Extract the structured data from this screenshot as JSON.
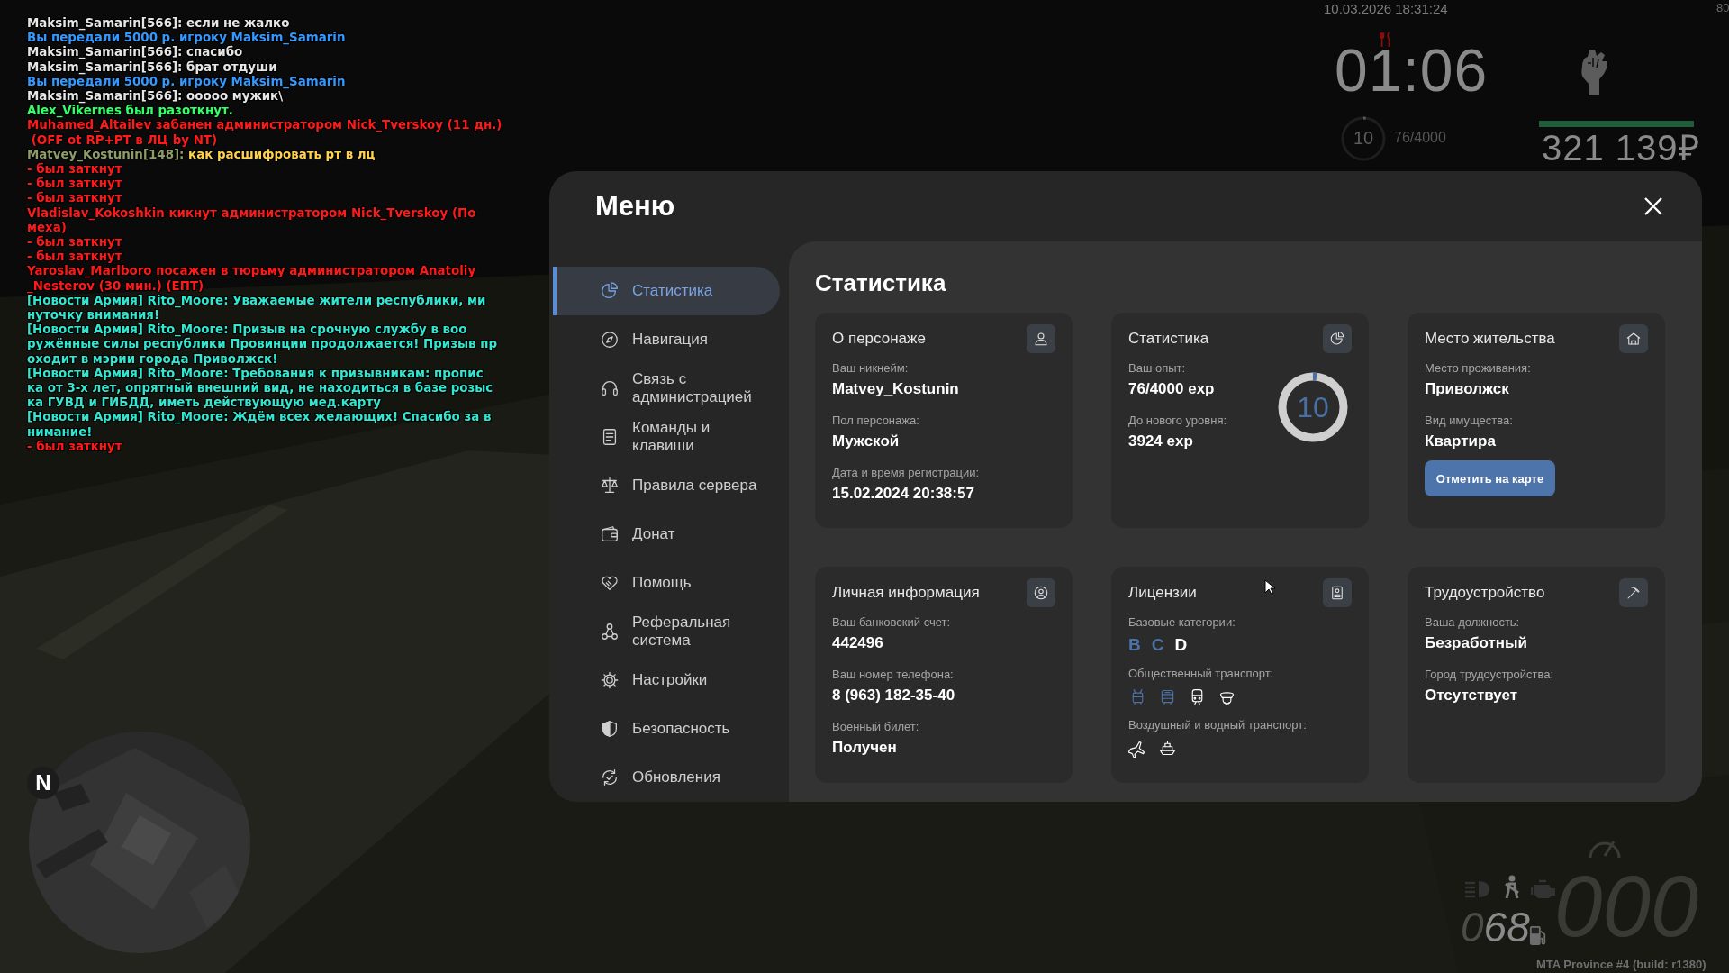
{
  "chat": [
    {
      "parts": [
        {
          "text": "Maksim_Samarin[566]: если не жалко",
          "color": "#e6e6e6"
        }
      ]
    },
    {
      "parts": [
        {
          "text": "Вы передали 5000 р. игроку Maksim_Samarin",
          "color": "#3399ff"
        }
      ]
    },
    {
      "parts": [
        {
          "text": "Maksim_Samarin[566]: спасибо",
          "color": "#e6e6e6"
        }
      ]
    },
    {
      "parts": [
        {
          "text": "Maksim_Samarin[566]: брат отдуши",
          "color": "#e6e6e6"
        }
      ]
    },
    {
      "parts": [
        {
          "text": "Вы передали 5000 р. игроку Maksim_Samarin",
          "color": "#3399ff"
        }
      ]
    },
    {
      "parts": [
        {
          "text": "Maksim_Samarin[566]: ооооо мужик\\",
          "color": "#e6e6e6"
        }
      ]
    },
    {
      "parts": [
        {
          "text": "Alex_Vikernes был разоткнут.",
          "color": "#33ff66"
        }
      ]
    },
    {
      "parts": [
        {
          "text": "Muhamed_Altailev забанен администратором Nick_Tverskoy (11 дн.)",
          "color": "#ff1a1a"
        }
      ]
    },
    {
      "parts": [
        {
          "text": " (OFF ot RP+PT в ЛЦ by NT)",
          "color": "#ff1a1a"
        }
      ]
    },
    {
      "parts": [
        {
          "text": "Matvey_Kostunin[148]: ",
          "color": "#8f9c6a"
        },
        {
          "text": "как расшифровать рт в лц",
          "color": "#ffd24d"
        }
      ]
    },
    {
      "parts": [
        {
          "text": "- был заткнут",
          "color": "#ff1a1a"
        }
      ]
    },
    {
      "parts": [
        {
          "text": "- был заткнут",
          "color": "#ff1a1a"
        }
      ]
    },
    {
      "parts": [
        {
          "text": "- был заткнут",
          "color": "#ff1a1a"
        }
      ]
    },
    {
      "parts": [
        {
          "text": "Vladislav_Kokoshkin кикнут администратором Nick_Tverskoy (По",
          "color": "#ff1a1a"
        }
      ]
    },
    {
      "parts": [
        {
          "text": "меха)",
          "color": "#ff1a1a"
        }
      ]
    },
    {
      "parts": [
        {
          "text": "- был заткнут",
          "color": "#ff1a1a"
        }
      ]
    },
    {
      "parts": [
        {
          "text": "- был заткнут",
          "color": "#ff1a1a"
        }
      ]
    },
    {
      "parts": [
        {
          "text": "Yaroslav_Marlboro посажен в тюрьму администратором Anatoliy",
          "color": "#ff1a1a"
        }
      ]
    },
    {
      "parts": [
        {
          "text": "_Nesterov (30 мин.) (ЕПТ)",
          "color": "#ff1a1a"
        }
      ]
    },
    {
      "parts": [
        {
          "text": "[Новости Армия] Rito_Moore: Уважаемые жители республики, ми",
          "color": "#33e6d0"
        }
      ]
    },
    {
      "parts": [
        {
          "text": "нуточку внимания!",
          "color": "#33e6d0"
        }
      ]
    },
    {
      "parts": [
        {
          "text": "[Новости Армия] Rito_Moore: Призыв на срочную службу в воо",
          "color": "#33e6d0"
        }
      ]
    },
    {
      "parts": [
        {
          "text": "ружённые силы республики Провинции продолжается! Призыв пр",
          "color": "#33e6d0"
        }
      ]
    },
    {
      "parts": [
        {
          "text": "оходит в мэрии города Приволжск!",
          "color": "#33e6d0"
        }
      ]
    },
    {
      "parts": [
        {
          "text": "[Новости Армия] Rito_Moore: Требования к призывникам: пропис",
          "color": "#33e6d0"
        }
      ]
    },
    {
      "parts": [
        {
          "text": "ка от 3-х лет, опрятный внешний вид, не находиться в базе розыс",
          "color": "#33e6d0"
        }
      ]
    },
    {
      "parts": [
        {
          "text": "ка ГУВД и ГИБДД, иметь действующую мед.карту",
          "color": "#33e6d0"
        }
      ]
    },
    {
      "parts": [
        {
          "text": "[Новости Армия] Rito_Moore: Ждём всех желающих! Спасибо за в",
          "color": "#33e6d0"
        }
      ]
    },
    {
      "parts": [
        {
          "text": "нимание!",
          "color": "#33e6d0"
        }
      ]
    },
    {
      "parts": [
        {
          "text": "- был заткнут",
          "color": "#ff1a1a"
        }
      ]
    }
  ],
  "hud": {
    "datetime": "10.03.2026 18:31:24",
    "fps": "80",
    "clock": "01:06",
    "level_ring": {
      "value": "10",
      "progress": "76/4000"
    },
    "health_bar": {
      "level": 1
    },
    "money": "321 139₽"
  },
  "menu": {
    "title": "Меню",
    "sidebar": {
      "items": [
        {
          "kind": "stats",
          "label": "Статистика",
          "selected": true
        },
        {
          "kind": "navigation",
          "label": "Навигация",
          "selected": false
        },
        {
          "kind": "support",
          "label": "Связь с\nадминистрацией",
          "selected": false
        },
        {
          "kind": "commands",
          "label": "Команды и\nклавиши",
          "selected": false
        },
        {
          "kind": "rules",
          "label": "Правила сервера",
          "selected": false
        },
        {
          "kind": "donate",
          "label": "Донат",
          "selected": false
        },
        {
          "kind": "help",
          "label": "Помощь",
          "selected": false
        },
        {
          "kind": "referral",
          "label": "Реферальная\nсистема",
          "selected": false
        },
        {
          "kind": "settings",
          "label": "Настройки",
          "selected": false
        },
        {
          "kind": "security",
          "label": "Безопасность",
          "selected": false
        },
        {
          "kind": "updates",
          "label": "Обновления",
          "selected": false
        }
      ]
    },
    "content": {
      "title": "Статистика",
      "cards": [
        {
          "kind": "character",
          "title": "О персонаже",
          "fields": [
            {
              "label": "Ваш никнейм:",
              "value": "Matvey_Kostunin"
            },
            {
              "label": "Пол персонажа:",
              "value": "Мужской"
            },
            {
              "label": "Дата и время регистрации:",
              "value": "15.02.2024 20:38:57"
            }
          ]
        },
        {
          "kind": "stats",
          "title": "Статистика",
          "fields": [
            {
              "label": "Ваш опыт:",
              "value": "76/4000 exp"
            },
            {
              "label": "До нового уровня:",
              "value": "3924 exp"
            }
          ],
          "ring": {
            "value": "10"
          }
        },
        {
          "kind": "residence",
          "title": "Место жительства",
          "fields": [
            {
              "label": "Место проживания:",
              "value": "Приволжск"
            },
            {
              "label": "Вид имущества:",
              "value": "Квартира"
            }
          ],
          "button": "Отметить на карте"
        },
        {
          "kind": "personal",
          "title": "Личная информация",
          "fields": [
            {
              "label": "Ваш банковский счет:",
              "value": "442496"
            },
            {
              "label": "Ваш номер телефона:",
              "value": "8 (963) 182-35-40"
            },
            {
              "label": "Военный билет:",
              "value": "Получен"
            }
          ]
        },
        {
          "kind": "licenses",
          "title": "Лицензии",
          "sections": [
            {
              "label": "Базовые категории:",
              "kind": "letters",
              "items": [
                {
                  "text": "B",
                  "owned": true
                },
                {
                  "text": "C",
                  "owned": true
                },
                {
                  "text": "D",
                  "owned": false
                }
              ]
            },
            {
              "label": "Общественный транспорт:",
              "kind": "icons",
              "items": [
                {
                  "kind": "trolleybus",
                  "owned": true
                },
                {
                  "kind": "bus",
                  "owned": true
                },
                {
                  "kind": "train",
                  "owned": false
                },
                {
                  "kind": "cap",
                  "owned": false
                }
              ]
            },
            {
              "label": "Воздушный и водный транспорт:",
              "kind": "icons",
              "items": [
                {
                  "kind": "airplane",
                  "owned": false
                },
                {
                  "kind": "ship",
                  "owned": false
                }
              ]
            }
          ]
        },
        {
          "kind": "job",
          "title": "Трудоустройство",
          "fields": [
            {
              "label": "Ваша должность:",
              "value": "Безработный"
            },
            {
              "label": "Город трудоустройства:",
              "value": "Отсутствует"
            }
          ]
        }
      ]
    }
  },
  "minimap": {
    "north": "N"
  },
  "speedometer": {
    "fuel": "068",
    "speed": "000"
  },
  "server_label": "MTA Province #4 (build: r1380)"
}
